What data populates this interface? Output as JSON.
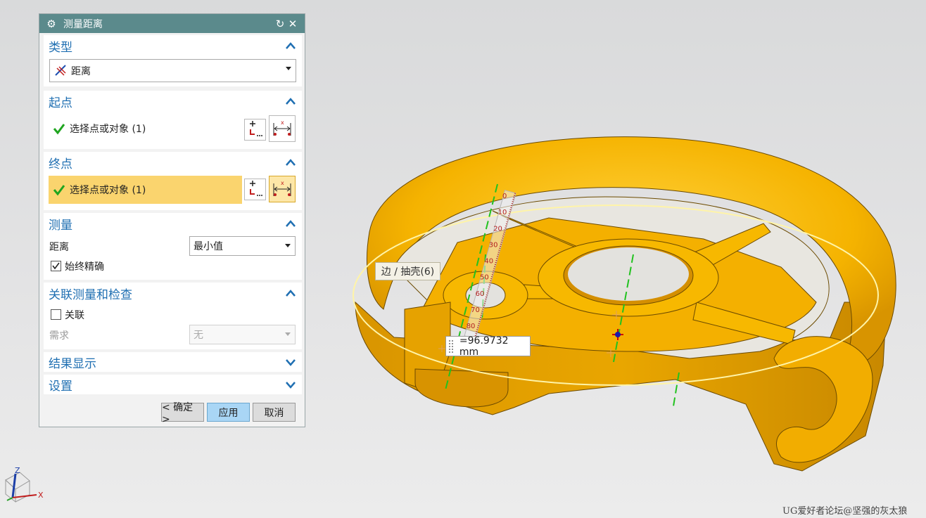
{
  "dialog": {
    "title": "测量距离",
    "sections": {
      "type": {
        "title": "类型",
        "value": "距离"
      },
      "start": {
        "title": "起点",
        "select_label": "选择点或对象 (1)"
      },
      "end": {
        "title": "终点",
        "select_label": "选择点或对象 (1)"
      },
      "measure": {
        "title": "测量",
        "distance_label": "距离",
        "distance_value": "最小值",
        "always_exact_label": "始终精确",
        "always_exact_checked": true
      },
      "assoc": {
        "title": "关联测量和检查",
        "assoc_label": "关联",
        "assoc_checked": false,
        "req_label": "需求",
        "req_value": "无"
      },
      "result": {
        "title": "结果显示"
      },
      "settings": {
        "title": "设置"
      }
    },
    "buttons": {
      "ok": "< 确定 >",
      "apply": "应用",
      "cancel": "取消"
    }
  },
  "viewport": {
    "tooltip": "边 / 抽壳(6)",
    "measurement": "=96.9732 mm",
    "ruler_ticks": [
      "0",
      "10",
      "20",
      "30",
      "40",
      "50",
      "60",
      "70",
      "80"
    ],
    "triad_axes": {
      "z": "Z",
      "x": "X"
    },
    "colors": {
      "part": "#f7b700",
      "part_dark": "#cc8c00",
      "highlight": "#fff4a8",
      "axis": "#21c21f"
    }
  },
  "watermark": "UG爱好者论坛@坚强的灰太狼"
}
